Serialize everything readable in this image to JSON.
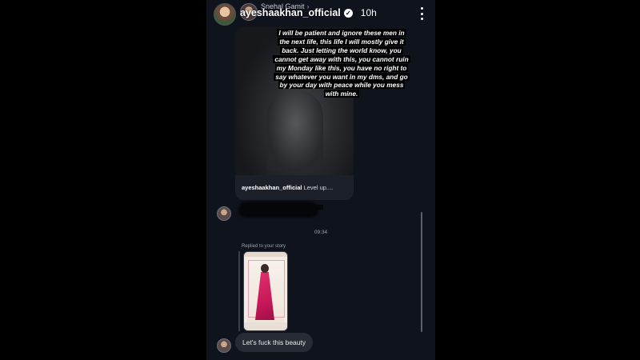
{
  "header": {
    "username": "ayeshaakhan_official",
    "time_ago": "10h",
    "sub_name": "Snehal Gamit",
    "sub_name_chevron": "›",
    "verified_glyph": "✓",
    "more_icon": "more-vertical-icon"
  },
  "story_overlay": {
    "lines": [
      "I will be patient and ignore these men in",
      "the next life, this life I will mostly give it",
      "back. Just letting the world know, you",
      "cannot get away with this, you cannot ruin",
      "my Monday like this, you have no right to",
      "say whatever you want in my dms, and go",
      "by your day with peace while you mess",
      "with mine."
    ]
  },
  "chat": {
    "post_caption_user": "ayeshaakhan_official",
    "post_caption_text": " Level up....",
    "timestamp": "09:34",
    "replied_label": "Replied to your story",
    "message": "Let's fuck this beauty"
  },
  "colors": {
    "background": "#000000",
    "chat_background": "#0f131c",
    "bubble": "#262b35",
    "meta_text": "#9ca2ad"
  }
}
